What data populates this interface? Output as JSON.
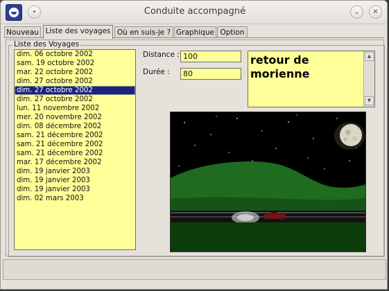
{
  "window": {
    "title": "Conduite accompagné"
  },
  "titlebar_buttons": {
    "shade": "•",
    "minimize": "⌄",
    "close": "✕"
  },
  "tabs": [
    {
      "label": "Nouveau",
      "active": false
    },
    {
      "label": "Liste des voyages",
      "active": true
    },
    {
      "label": "Où en suis-je ?",
      "active": false
    },
    {
      "label": "Graphique",
      "active": false
    },
    {
      "label": "Option",
      "active": false
    }
  ],
  "group": {
    "title": "Liste des Voyages"
  },
  "trips": [
    {
      "label": "dim. 06 octobre 2002",
      "selected": false
    },
    {
      "label": "sam. 19 octobre 2002",
      "selected": false
    },
    {
      "label": "mar. 22 octobre 2002",
      "selected": false
    },
    {
      "label": "dim. 27 octobre 2002",
      "selected": false
    },
    {
      "label": "dim. 27 octobre 2002",
      "selected": true
    },
    {
      "label": "dim. 27 octobre 2002",
      "selected": false
    },
    {
      "label": "lun. 11 novembre 2002",
      "selected": false
    },
    {
      "label": "mer. 20 novembre 2002",
      "selected": false
    },
    {
      "label": "dim. 08 décembre 2002",
      "selected": false
    },
    {
      "label": "sam. 21 décembre 2002",
      "selected": false
    },
    {
      "label": "sam. 21 décembre 2002",
      "selected": false
    },
    {
      "label": "sam. 21 décembre 2002",
      "selected": false
    },
    {
      "label": "mar. 17 décembre 2002",
      "selected": false
    },
    {
      "label": "dim. 19 janvier 2003",
      "selected": false
    },
    {
      "label": "dim. 19 janvier 2003",
      "selected": false
    },
    {
      "label": "dim. 19 janvier 2003",
      "selected": false
    },
    {
      "label": "dim. 02 mars 2003",
      "selected": false
    }
  ],
  "details": {
    "distance_label": "Distance :",
    "distance_value": "100",
    "duree_label": "Durée :",
    "duree_value": "80",
    "notes": "retour de morienne"
  },
  "scroll": {
    "up": "▲",
    "down": "▼"
  },
  "colors": {
    "field_bg": "#ffff99",
    "selection": "#1a237e",
    "sky": "#000000",
    "hills": "#1f6b1f"
  }
}
